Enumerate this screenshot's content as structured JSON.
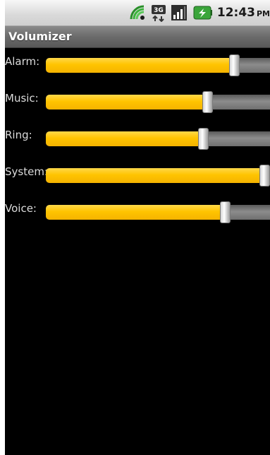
{
  "status_bar": {
    "time": "12:43",
    "ampm": "PM",
    "icons": [
      "wifi-icon",
      "3g-network-icon",
      "signal-strength-icon",
      "battery-charging-icon"
    ]
  },
  "app": {
    "title": "Volumizer"
  },
  "sliders": [
    {
      "label": "Alarm:",
      "level": 0.86
    },
    {
      "label": "Music:",
      "level": 0.74
    },
    {
      "label": "Ring:",
      "level": 0.72
    },
    {
      "label": "System:",
      "level": 1.0
    },
    {
      "label": "Voice:",
      "level": 0.82
    }
  ],
  "colors": {
    "fill": "#ffc400",
    "track": "#7a7a7a",
    "background": "#000000",
    "title_bar": "#6b6b6b"
  }
}
